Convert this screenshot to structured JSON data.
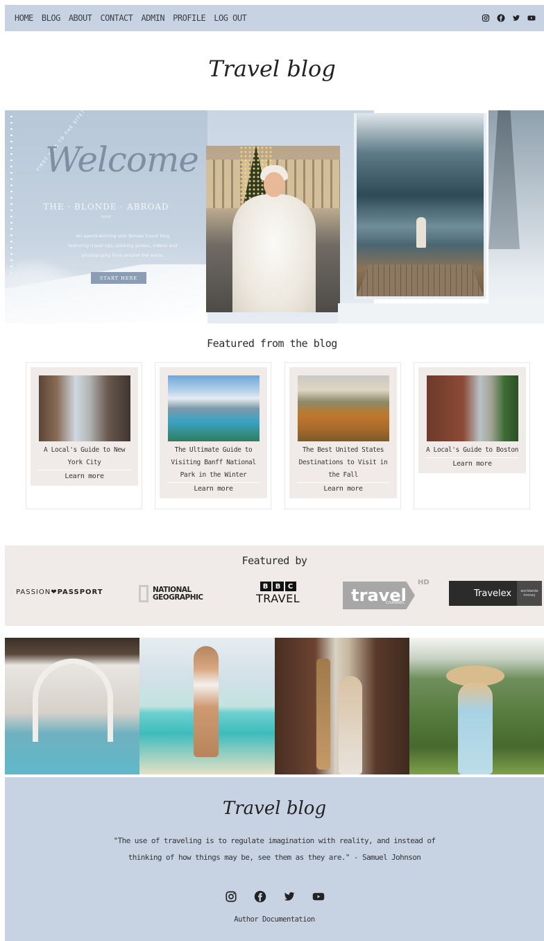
{
  "nav": {
    "links": [
      "HOME",
      "BLOG",
      "ABOUT",
      "CONTACT",
      "ADMIN",
      "PROFILE",
      "LOG OUT"
    ],
    "social_icons": [
      "instagram-icon",
      "facebook-icon",
      "twitter-icon",
      "youtube-icon"
    ]
  },
  "site_title": "Travel blog",
  "hero": {
    "first_time": "FIRST TIME TO THE SITE?",
    "welcome": "Welcome to",
    "brand": "THE · BLONDE · ABROAD",
    "noun": "noun",
    "description": "An award-winning solo female travel blog featuring travel tips, packing guides, videos and photography from around the world.",
    "button_label": "START HERE"
  },
  "featured_blog": {
    "title": "Featured from the blog",
    "posts": [
      {
        "title": "A Local's Guide to New York City",
        "more": "Learn more"
      },
      {
        "title": "The Ultimate Guide to Visiting Banff National Park in the Winter",
        "more": "Learn more"
      },
      {
        "title": "The Best United States Destinations to Visit in the Fall",
        "more": "Learn more"
      },
      {
        "title": "A Local's Guide to Boston",
        "more": "Learn more"
      }
    ]
  },
  "featured_by": {
    "title": "Featured by",
    "passion_a": "PASSION",
    "passion_b": "PASSPORT",
    "natgeo_line1": "NATIONAL",
    "natgeo_line2": "GEOGRAPHIC",
    "bbc_b1": "B",
    "bbc_b2": "B",
    "bbc_c": "C",
    "bbc_travel": "TRAVEL",
    "travel_word": "travel",
    "travel_channel": "CHANNEL",
    "travel_hd": "HD",
    "travelex": "Travelex",
    "travelex_tag": "worldwide money"
  },
  "footer": {
    "title": "Travel blog",
    "quote": "\"The use of traveling is to regulate imagination with reality, and instead of thinking of how things may be, see them as they are.\" - Samuel Johnson",
    "doc_link": "Author Documentation"
  },
  "colors": {
    "nav_bg": "#c7d3e2",
    "card_bg": "#f0ebe8",
    "footer_bg": "#c7d3e2"
  }
}
